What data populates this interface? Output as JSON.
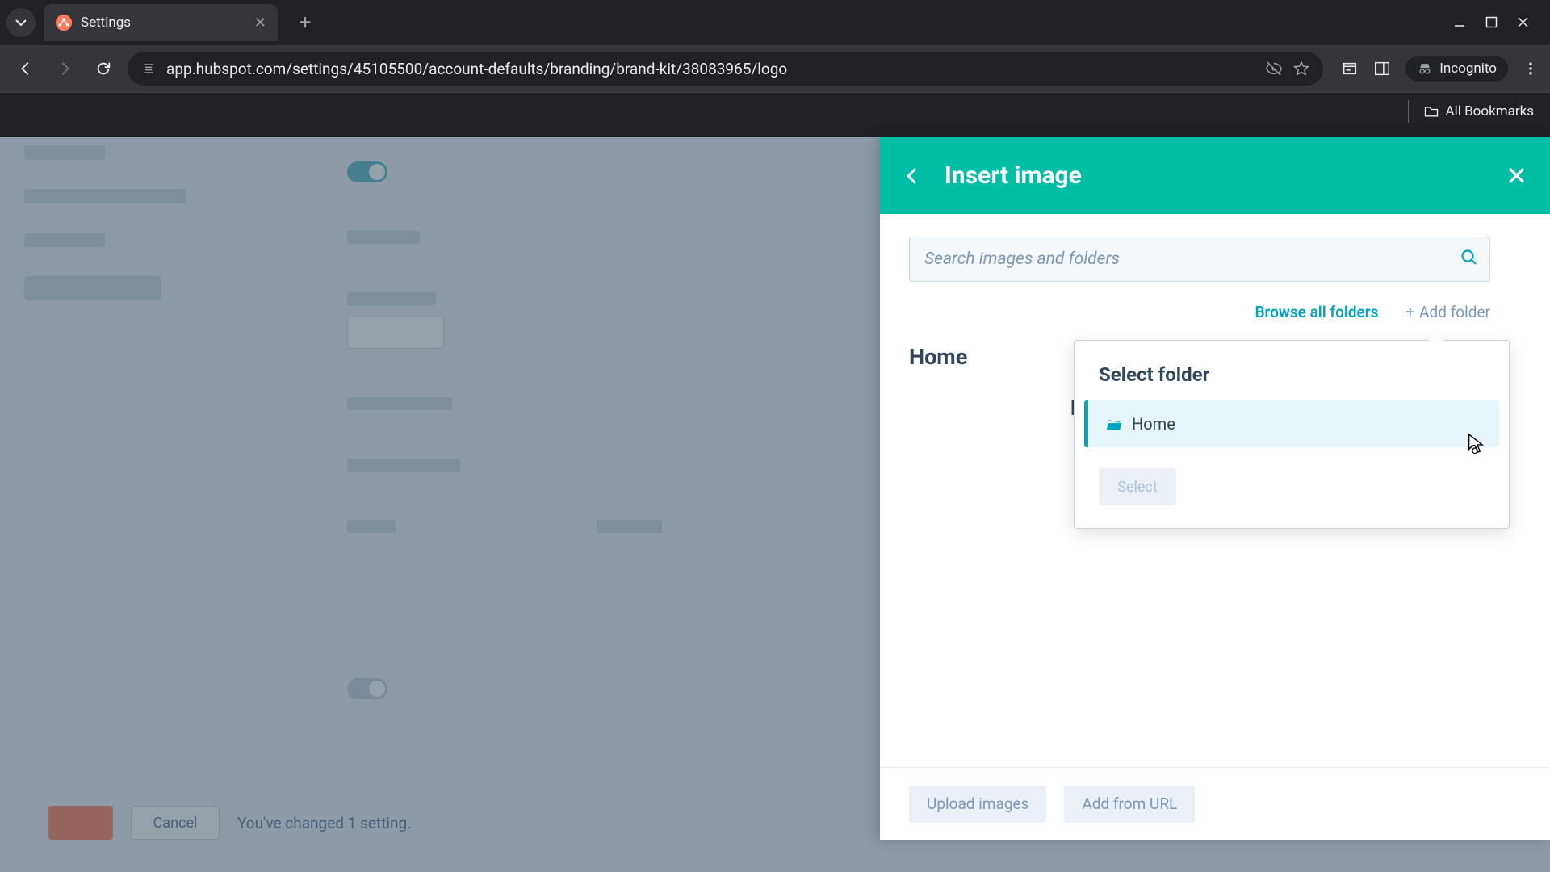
{
  "browser": {
    "tab_title": "Settings",
    "url": "app.hubspot.com/settings/45105500/account-defaults/branding/brand-kit/38083965/logo",
    "incognito_label": "Incognito",
    "all_bookmarks": "All Bookmarks"
  },
  "background_page": {
    "cancel_label": "Cancel",
    "status_text": "You've changed 1 setting."
  },
  "drawer": {
    "title": "Insert image",
    "search_placeholder": "Search images and folders",
    "browse_all_label": "Browse all folders",
    "add_folder_label": "Add folder",
    "home_heading": "Home",
    "partial_text": "N",
    "footer_upload": "Upload images",
    "footer_add_url": "Add from URL"
  },
  "popover": {
    "title": "Select folder",
    "folder_name": "Home",
    "select_label": "Select"
  },
  "colors": {
    "teal": "#00bda5",
    "link_teal": "#00a4bd"
  }
}
